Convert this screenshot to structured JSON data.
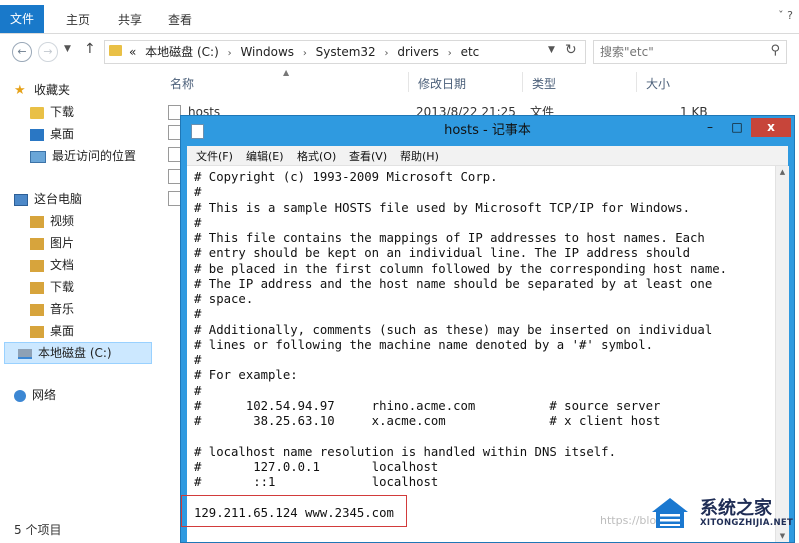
{
  "ribbon": {
    "tabs": [
      "文件",
      "主页",
      "共享",
      "查看"
    ],
    "controls": "ˇ ?"
  },
  "address": {
    "crumbs": [
      "«",
      "本地磁盘 (C:)",
      "›",
      "Windows",
      "›",
      "System32",
      "›",
      "drivers",
      "›",
      "etc"
    ],
    "search_placeholder": "搜索\"etc\""
  },
  "nav": {
    "favorites": "收藏夹",
    "downloads": "下载",
    "desktop": "桌面",
    "recent": "最近访问的位置",
    "this_pc": "这台电脑",
    "videos": "视频",
    "pictures": "图片",
    "documents": "文档",
    "downloads2": "下载",
    "music": "音乐",
    "desktop2": "桌面",
    "c_drive": "本地磁盘 (C:)",
    "network": "网络"
  },
  "status": "5 个项目",
  "filelist": {
    "columns": [
      "名称",
      "修改日期",
      "类型",
      "大小"
    ],
    "row1": {
      "name": "hosts",
      "date": "2013/8/22 21:25",
      "type": "文件",
      "size": "1 KB"
    }
  },
  "notepad": {
    "title": "hosts - 记事本",
    "controls": {
      "min": "–",
      "max": "□",
      "close": "x"
    },
    "menu": [
      "文件(F)",
      "编辑(E)",
      "格式(O)",
      "查看(V)",
      "帮助(H)"
    ],
    "content": "# Copyright (c) 1993-2009 Microsoft Corp.\n#\n# This is a sample HOSTS file used by Microsoft TCP/IP for Windows.\n#\n# This file contains the mappings of IP addresses to host names. Each\n# entry should be kept on an individual line. The IP address should\n# be placed in the first column followed by the corresponding host name.\n# The IP address and the host name should be separated by at least one\n# space.\n#\n# Additionally, comments (such as these) may be inserted on individual\n# lines or following the machine name denoted by a '#' symbol.\n#\n# For example:\n#\n#      102.54.94.97     rhino.acme.com          # source server\n#       38.25.63.10     x.acme.com              # x client host\n\n# localhost name resolution is handled within DNS itself.\n#\t127.0.0.1       localhost\n#\t::1             localhost\n\n129.211.65.124 www.2345.com"
  },
  "watermark": {
    "faint": "https://blog.cs",
    "brand_cn": "系统之家",
    "brand_en": "XITONGZHIJIA.NET"
  },
  "colors": {
    "accent": "#1979ca",
    "notepad_frame": "#2f9ae0",
    "close_button": "#c7453a",
    "highlight": "#d23b3b",
    "selection": "#cce8ff"
  }
}
